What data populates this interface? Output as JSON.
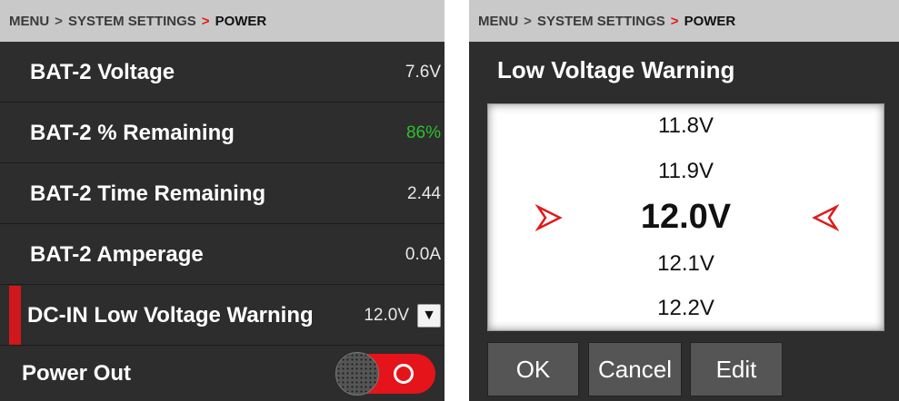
{
  "left_screen": {
    "breadcrumb": {
      "menu": "MENU",
      "sep1": ">",
      "section": "SYSTEM SETTINGS",
      "sep2": ">",
      "current": "POWER"
    },
    "rows": [
      {
        "label": "BAT-2 Voltage",
        "value": "7.6V"
      },
      {
        "label": "BAT-2 % Remaining",
        "value": "86%"
      },
      {
        "label": "BAT-2 Time Remaining",
        "value": "2.44"
      },
      {
        "label": "BAT-2 Amperage",
        "value": "0.0A"
      },
      {
        "label": "DC-IN Low Voltage Warning",
        "value": "12.0V",
        "control": "dropdown"
      },
      {
        "label": "Power Out",
        "control": "toggle",
        "state": "on"
      }
    ],
    "dropdown_icon": "caret-down-icon"
  },
  "right_screen": {
    "breadcrumb": {
      "menu": "MENU",
      "sep1": ">",
      "section": "SYSTEM SETTINGS",
      "sep2": ">",
      "current": "POWER"
    },
    "title": "Low Voltage Warning",
    "picker": {
      "options": [
        "11.8V",
        "11.9V",
        "12.0V",
        "12.1V",
        "12.2V"
      ],
      "selected": "12.0V"
    },
    "buttons": {
      "ok": "OK",
      "cancel": "Cancel",
      "edit": "Edit"
    }
  },
  "colors": {
    "accent_red": "#e01a1a",
    "panel_bg": "#2d2d2d",
    "breadcrumb_bg": "#c9c9c9",
    "percent_green": "#2fbf2f",
    "button_bg": "#555555"
  }
}
